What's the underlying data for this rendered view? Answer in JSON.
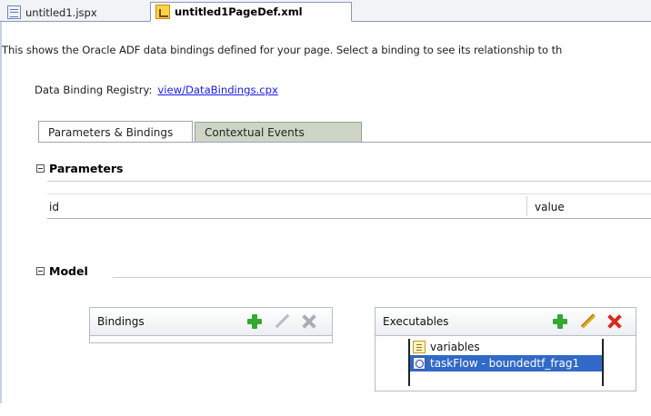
{
  "editor_tabs": [
    {
      "label": "untitled1.jspx",
      "icon": "jspx-file-icon",
      "active": false
    },
    {
      "label": "untitled1PageDef.xml",
      "icon": "xml-file-icon",
      "active": true
    }
  ],
  "intro_text": "This shows the Oracle ADF data bindings defined for your page. Select a binding to see its relationship to th",
  "registry": {
    "label": "Data Binding Registry:",
    "link": "view/DataBindings.cpx"
  },
  "inner_tabs": [
    {
      "label": "Parameters & Bindings",
      "selected": true
    },
    {
      "label": "Contextual Events",
      "selected": false
    }
  ],
  "parameters": {
    "heading": "Parameters",
    "columns": [
      "id",
      "value"
    ]
  },
  "model": {
    "heading": "Model",
    "bindings_panel": {
      "title": "Bindings",
      "items": []
    },
    "executables_panel": {
      "title": "Executables",
      "items": [
        {
          "label": "variables",
          "icon": "variables-icon",
          "selected": false
        },
        {
          "label": "taskFlow - boundedtf_frag1",
          "icon": "taskflow-icon",
          "selected": true
        }
      ]
    }
  },
  "colors": {
    "selection": "#3169c6",
    "link": "#1a1aee",
    "add": "#35a832",
    "delete": "#d9281c",
    "edit": "#e0a81a"
  }
}
